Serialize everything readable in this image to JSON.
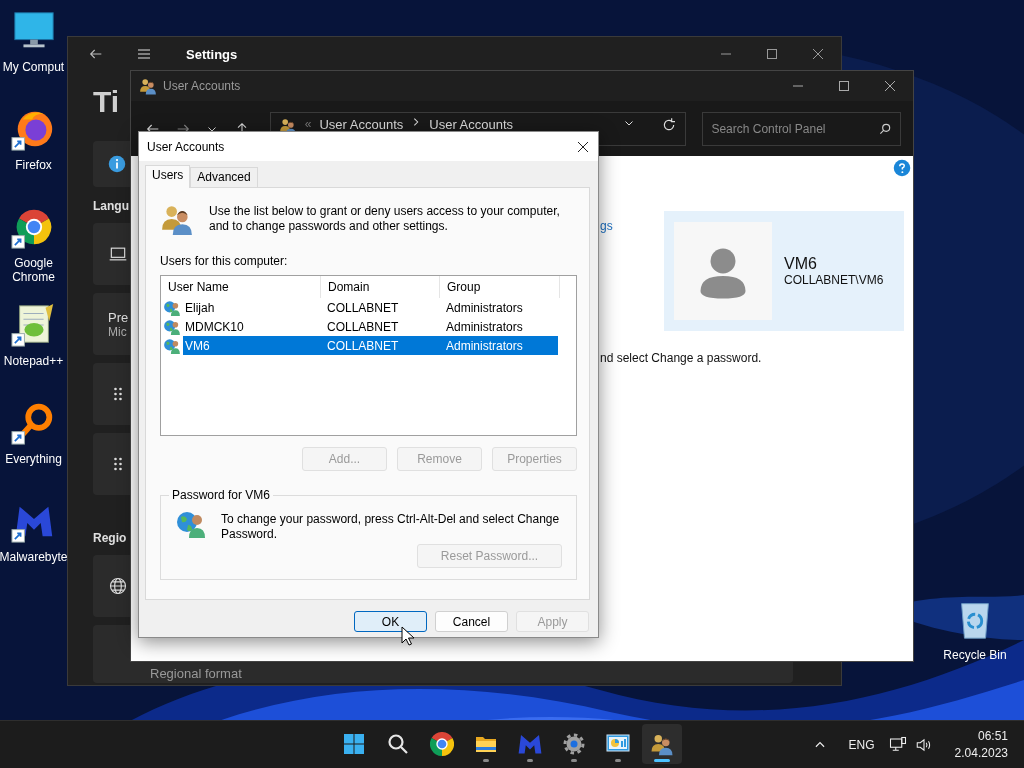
{
  "desktop_icons": [
    {
      "label": "My Comput",
      "kind": "computer",
      "shortcut": false
    },
    {
      "label": "Firefox",
      "kind": "firefox",
      "shortcut": true
    },
    {
      "label": "Google Chrome",
      "kind": "chrome",
      "shortcut": true
    },
    {
      "label": "Notepad++",
      "kind": "notepad",
      "shortcut": true
    },
    {
      "label": "Everything",
      "kind": "everything",
      "shortcut": true
    },
    {
      "label": "Malwarebyte",
      "kind": "malware",
      "shortcut": true
    }
  ],
  "recycle_bin": {
    "label": "Recycle Bin"
  },
  "settings_window": {
    "title": "Settings",
    "page_title": "Ti",
    "items": [
      {
        "kind": "info"
      },
      {
        "kind": "section",
        "text": "Langu"
      },
      {
        "kind": "device"
      },
      {
        "kind": "text",
        "title": "Pre",
        "subtitle": "Mic"
      },
      {
        "kind": "grip"
      },
      {
        "kind": "grip"
      },
      {
        "kind": "section",
        "text": "Regio"
      },
      {
        "kind": "globe"
      },
      {
        "kind": "label",
        "title": "Regional format"
      }
    ]
  },
  "control_panel": {
    "title": "User Accounts",
    "overflow_mark": "«",
    "breadcrumb": [
      "User Accounts",
      "User Accounts"
    ],
    "search_placeholder": "Search Control Panel",
    "link": "gs",
    "instruction": "nd select Change a password.",
    "user": {
      "name": "VM6",
      "account": "COLLABNET\\VM6"
    }
  },
  "dialog": {
    "title": "User Accounts",
    "tabs": [
      {
        "label": "Users",
        "selected": true
      },
      {
        "label": "Advanced",
        "selected": false
      }
    ],
    "intro": "Use the list below to grant or deny users access to your computer, and to change passwords and other settings.",
    "list_label": "Users for this computer:",
    "columns": [
      "User Name",
      "Domain",
      "Group"
    ],
    "rows": [
      {
        "cells": [
          "Elijah",
          "COLLABNET",
          "Administrators"
        ],
        "selected": false
      },
      {
        "cells": [
          "MDMCK10",
          "COLLABNET",
          "Administrators"
        ],
        "selected": false
      },
      {
        "cells": [
          "VM6",
          "COLLABNET",
          "Administrators"
        ],
        "selected": true
      }
    ],
    "list_buttons": [
      {
        "label": "Add...",
        "disabled": true
      },
      {
        "label": "Remove",
        "disabled": true
      },
      {
        "label": "Properties",
        "disabled": true
      }
    ],
    "password": {
      "title": "Password for VM6",
      "text": "To change your password, press Ctrl-Alt-Del and select Change Password.",
      "button": {
        "label": "Reset Password...",
        "disabled": true
      }
    },
    "buttons": [
      {
        "label": "OK",
        "disabled": false,
        "default": true
      },
      {
        "label": "Cancel",
        "disabled": false,
        "default": false
      },
      {
        "label": "Apply",
        "disabled": true,
        "default": false
      }
    ]
  },
  "taskbar": {
    "apps": [
      {
        "kind": "start",
        "running": false,
        "active": false
      },
      {
        "kind": "search",
        "running": false,
        "active": false
      },
      {
        "kind": "chrome",
        "running": false,
        "active": false
      },
      {
        "kind": "folder",
        "running": true,
        "active": false
      },
      {
        "kind": "malware",
        "running": true,
        "active": false
      },
      {
        "kind": "gear",
        "running": true,
        "active": false
      },
      {
        "kind": "panel",
        "running": true,
        "active": false
      },
      {
        "kind": "users",
        "running": true,
        "active": true
      }
    ],
    "language": "ENG",
    "time": "06:51",
    "date": "2.04.2023"
  }
}
